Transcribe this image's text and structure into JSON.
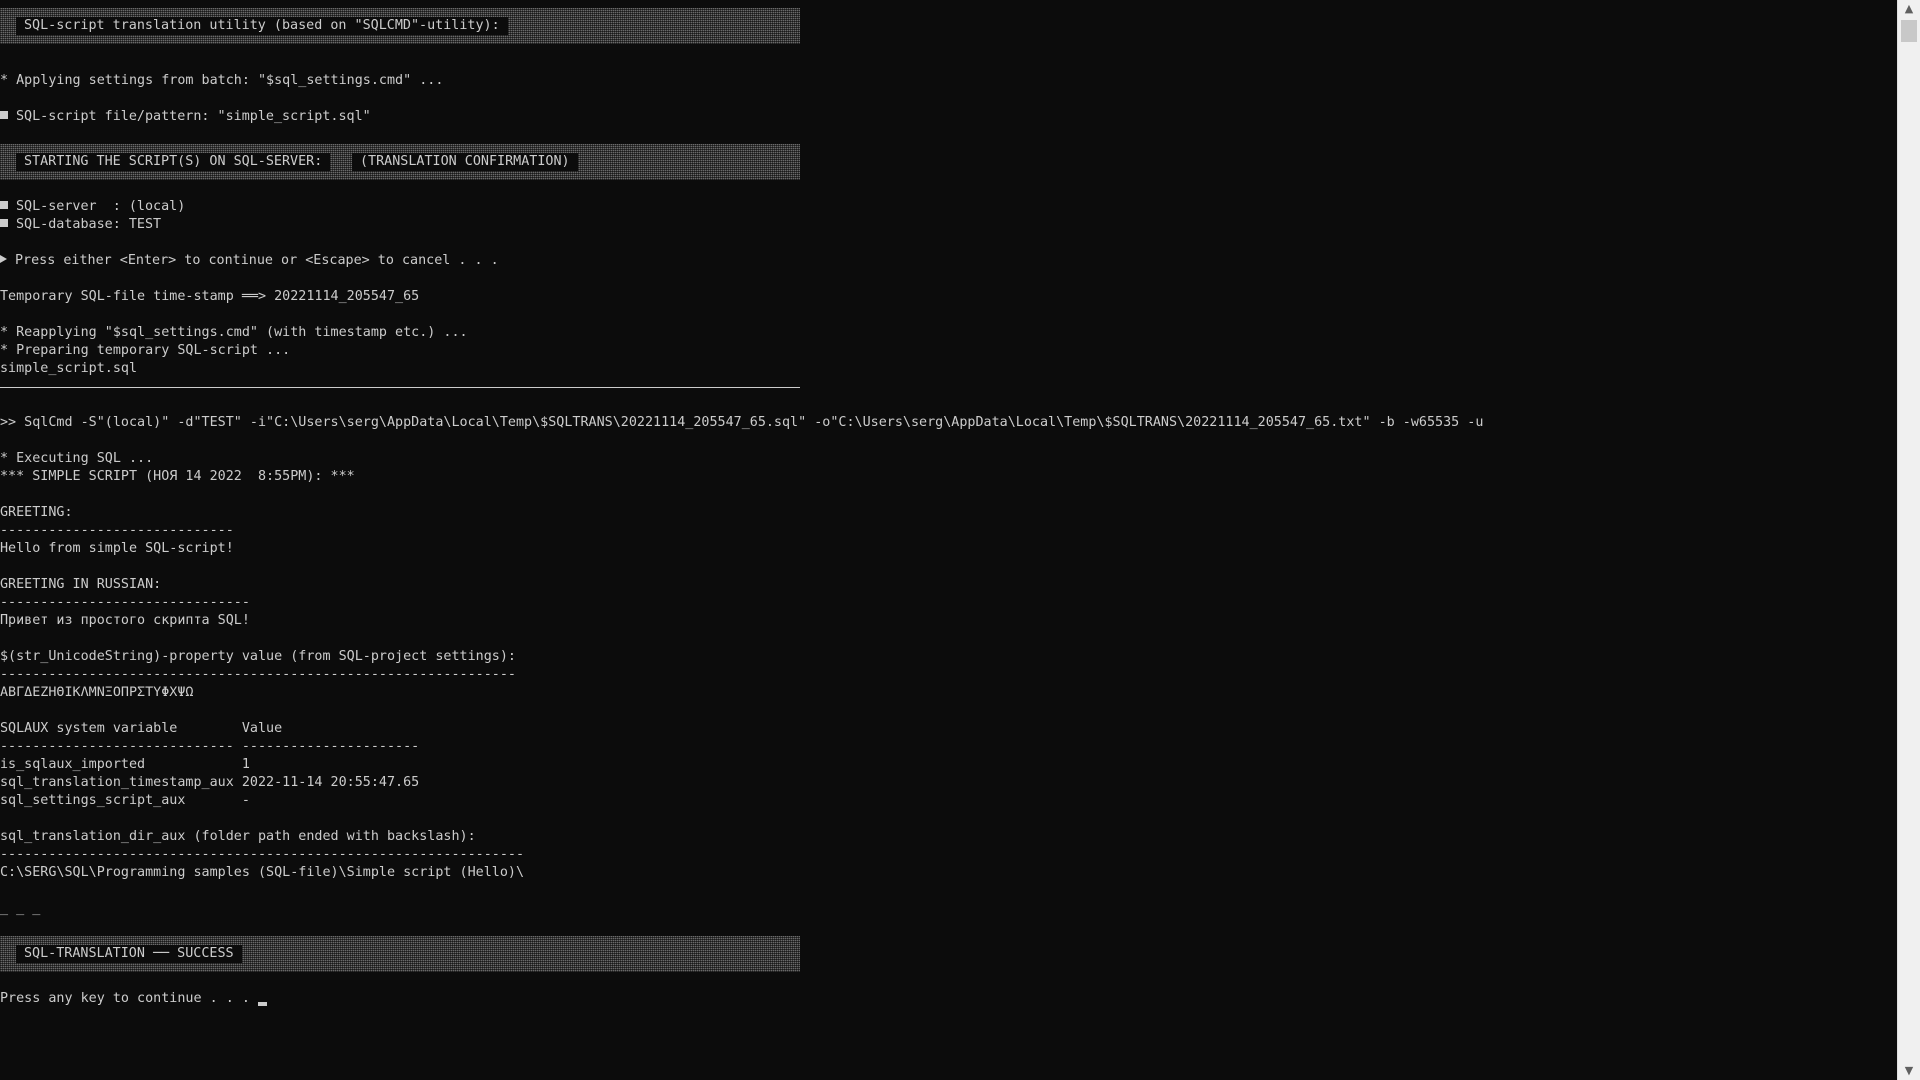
{
  "colors": {
    "background": "#0c0c0c",
    "text": "#cccccc",
    "banner": "#6a6a6a",
    "scrollbar": "#f0f0f0"
  },
  "banners": {
    "title": "SQL-script translation utility (based on \"SQLCMD\"-utility):",
    "starting_left": "STARTING THE SCRIPT(S) ON SQL-SERVER:",
    "starting_right": "(TRANSLATION CONFIRMATION)",
    "success": "SQL-TRANSLATION ── SUCCESS"
  },
  "lines": {
    "applying": "* Applying settings from batch: \"$sql_settings.cmd\" ...",
    "file_pattern": "SQL-script file/pattern: \"simple_script.sql\"",
    "server": "SQL-server  : (local)",
    "database": "SQL-database: TEST",
    "press_enter": "Press either <Enter> to continue or <Escape> to cancel . . .",
    "timestamp": "Temporary SQL-file time-stamp ══> 20221114_205547_65",
    "reapplying": "* Reapplying \"$sql_settings.cmd\" (with timestamp etc.) ...",
    "preparing": "* Preparing temporary SQL-script ...",
    "script_name": "simple_script.sql",
    "sqlcmd": ">> SqlCmd -S\"(local)\" -d\"TEST\" -i\"C:\\Users\\serg\\AppData\\Local\\Temp\\$SQLTRANS\\20221114_205547_65.sql\" -o\"C:\\Users\\serg\\AppData\\Local\\Temp\\$SQLTRANS\\20221114_205547_65.txt\" -b -w65535 -u",
    "executing": "* Executing SQL ...",
    "simple_script": "*** SIMPLE SCRIPT (НОЯ 14 2022  8:55PM): ***",
    "greeting_hdr": "GREETING:",
    "greeting_sep": "-----------------------------",
    "greeting_val": "Hello from simple SQL-script!",
    "greeting_ru_hdr": "GREETING IN RUSSIAN:",
    "greeting_ru_sep": "-------------------------------",
    "greeting_ru_val": "Привет из простого скрипта SQL!",
    "unicode_hdr": "$(str_UnicodeString)-property value (from SQL-project settings):",
    "unicode_sep": "----------------------------------------------------------------",
    "unicode_val": "ΑΒΓΔΕΖΗΘΙΚΛΜΝΞΟΠΡΣΤΥΦΧΨΩ",
    "table_hdr": "SQLAUX system variable        Value",
    "table_sep": "----------------------------- ----------------------",
    "row1": "is_sqlaux_imported            1",
    "row2": "sql_translation_timestamp_aux 2022-11-14 20:55:47.65",
    "row3": "sql_settings_script_aux       -",
    "dir_hdr": "sql_translation_dir_aux (folder path ended with backslash):",
    "dir_sep": "-----------------------------------------------------------------",
    "dir_val": "C:\\SERG\\SQL\\Programming samples (SQL-file)\\Simple script (Hello)\\",
    "dashes": "_ _ _",
    "press_any": "Press any key to continue . . ."
  },
  "scrollbar": {
    "up_icon": "▲",
    "down_icon": "▼"
  }
}
